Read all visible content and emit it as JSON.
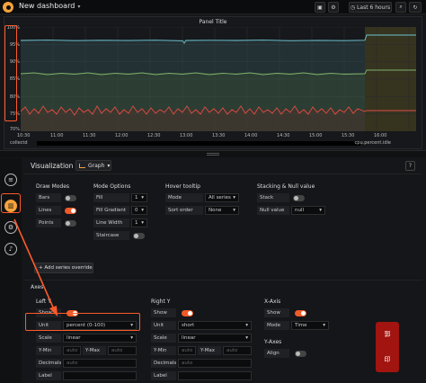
{
  "header": {
    "title": "New dashboard",
    "time_range": "Last 6 hours",
    "save_icon": "save-icon",
    "settings_icon": "gear-icon"
  },
  "panel": {
    "title": "Panel Title",
    "y_ticks": [
      "100%",
      "95%",
      "90%",
      "85%",
      "80%",
      "75%",
      "70%"
    ],
    "x_ticks": [
      "10:30",
      "11:00",
      "11:30",
      "12:00",
      "12:30",
      "13:00",
      "13:30",
      "14:00",
      "14:30",
      "15:00",
      "15:30",
      "16:00"
    ],
    "legend_left": "collectd",
    "legend_right": "cpu.percent.idle"
  },
  "visualization": {
    "label": "Visualization",
    "type": "Graph",
    "help": "?"
  },
  "draw_modes": {
    "title": "Draw Modes",
    "bars": "Bars",
    "lines": "Lines",
    "points": "Points",
    "bars_on": false,
    "lines_on": true,
    "points_on": false
  },
  "mode_options": {
    "title": "Mode Options",
    "fill": "Fill",
    "fill_value": "1",
    "fill_gradient": "Fill Gradient",
    "fill_gradient_value": "0",
    "line_width": "Line Width",
    "line_width_value": "1",
    "staircase": "Staircase"
  },
  "hover": {
    "title": "Hover tooltip",
    "mode": "Mode",
    "mode_value": "All series",
    "sort": "Sort order",
    "sort_value": "None"
  },
  "stacking": {
    "title": "Stacking & Null value",
    "stack": "Stack",
    "null_value": "Null value",
    "null_value_value": "null"
  },
  "add_override": "Add series override",
  "axes": {
    "title": "Axes",
    "left_y": {
      "title": "Left Y",
      "show": "Show",
      "unit": "Unit",
      "unit_value": "percent (0-100)",
      "scale": "Scale",
      "scale_value": "linear",
      "ymin": "Y-Min",
      "ymax": "Y-Max",
      "auto": "auto",
      "decimals": "Decimals",
      "label": "Label"
    },
    "right_y": {
      "title": "Right Y",
      "show": "Show",
      "unit": "Unit",
      "unit_value": "short",
      "scale": "Scale",
      "scale_value": "linear",
      "ymin": "Y-Min",
      "ymax": "Y-Max",
      "auto": "auto",
      "decimals": "Decimals",
      "label": "Label"
    },
    "x_axis": {
      "title": "X-Axis",
      "show": "Show",
      "mode": "Mode",
      "mode_value": "Time"
    },
    "y_axes": {
      "title": "Y-Axes",
      "align": "Align"
    }
  },
  "colors": {
    "accent": "#f6a23b",
    "annotation": "#ff5a2a",
    "series_teal": "#6fc3cf",
    "series_green": "#7eb26d",
    "series_red": "#e24d42"
  }
}
